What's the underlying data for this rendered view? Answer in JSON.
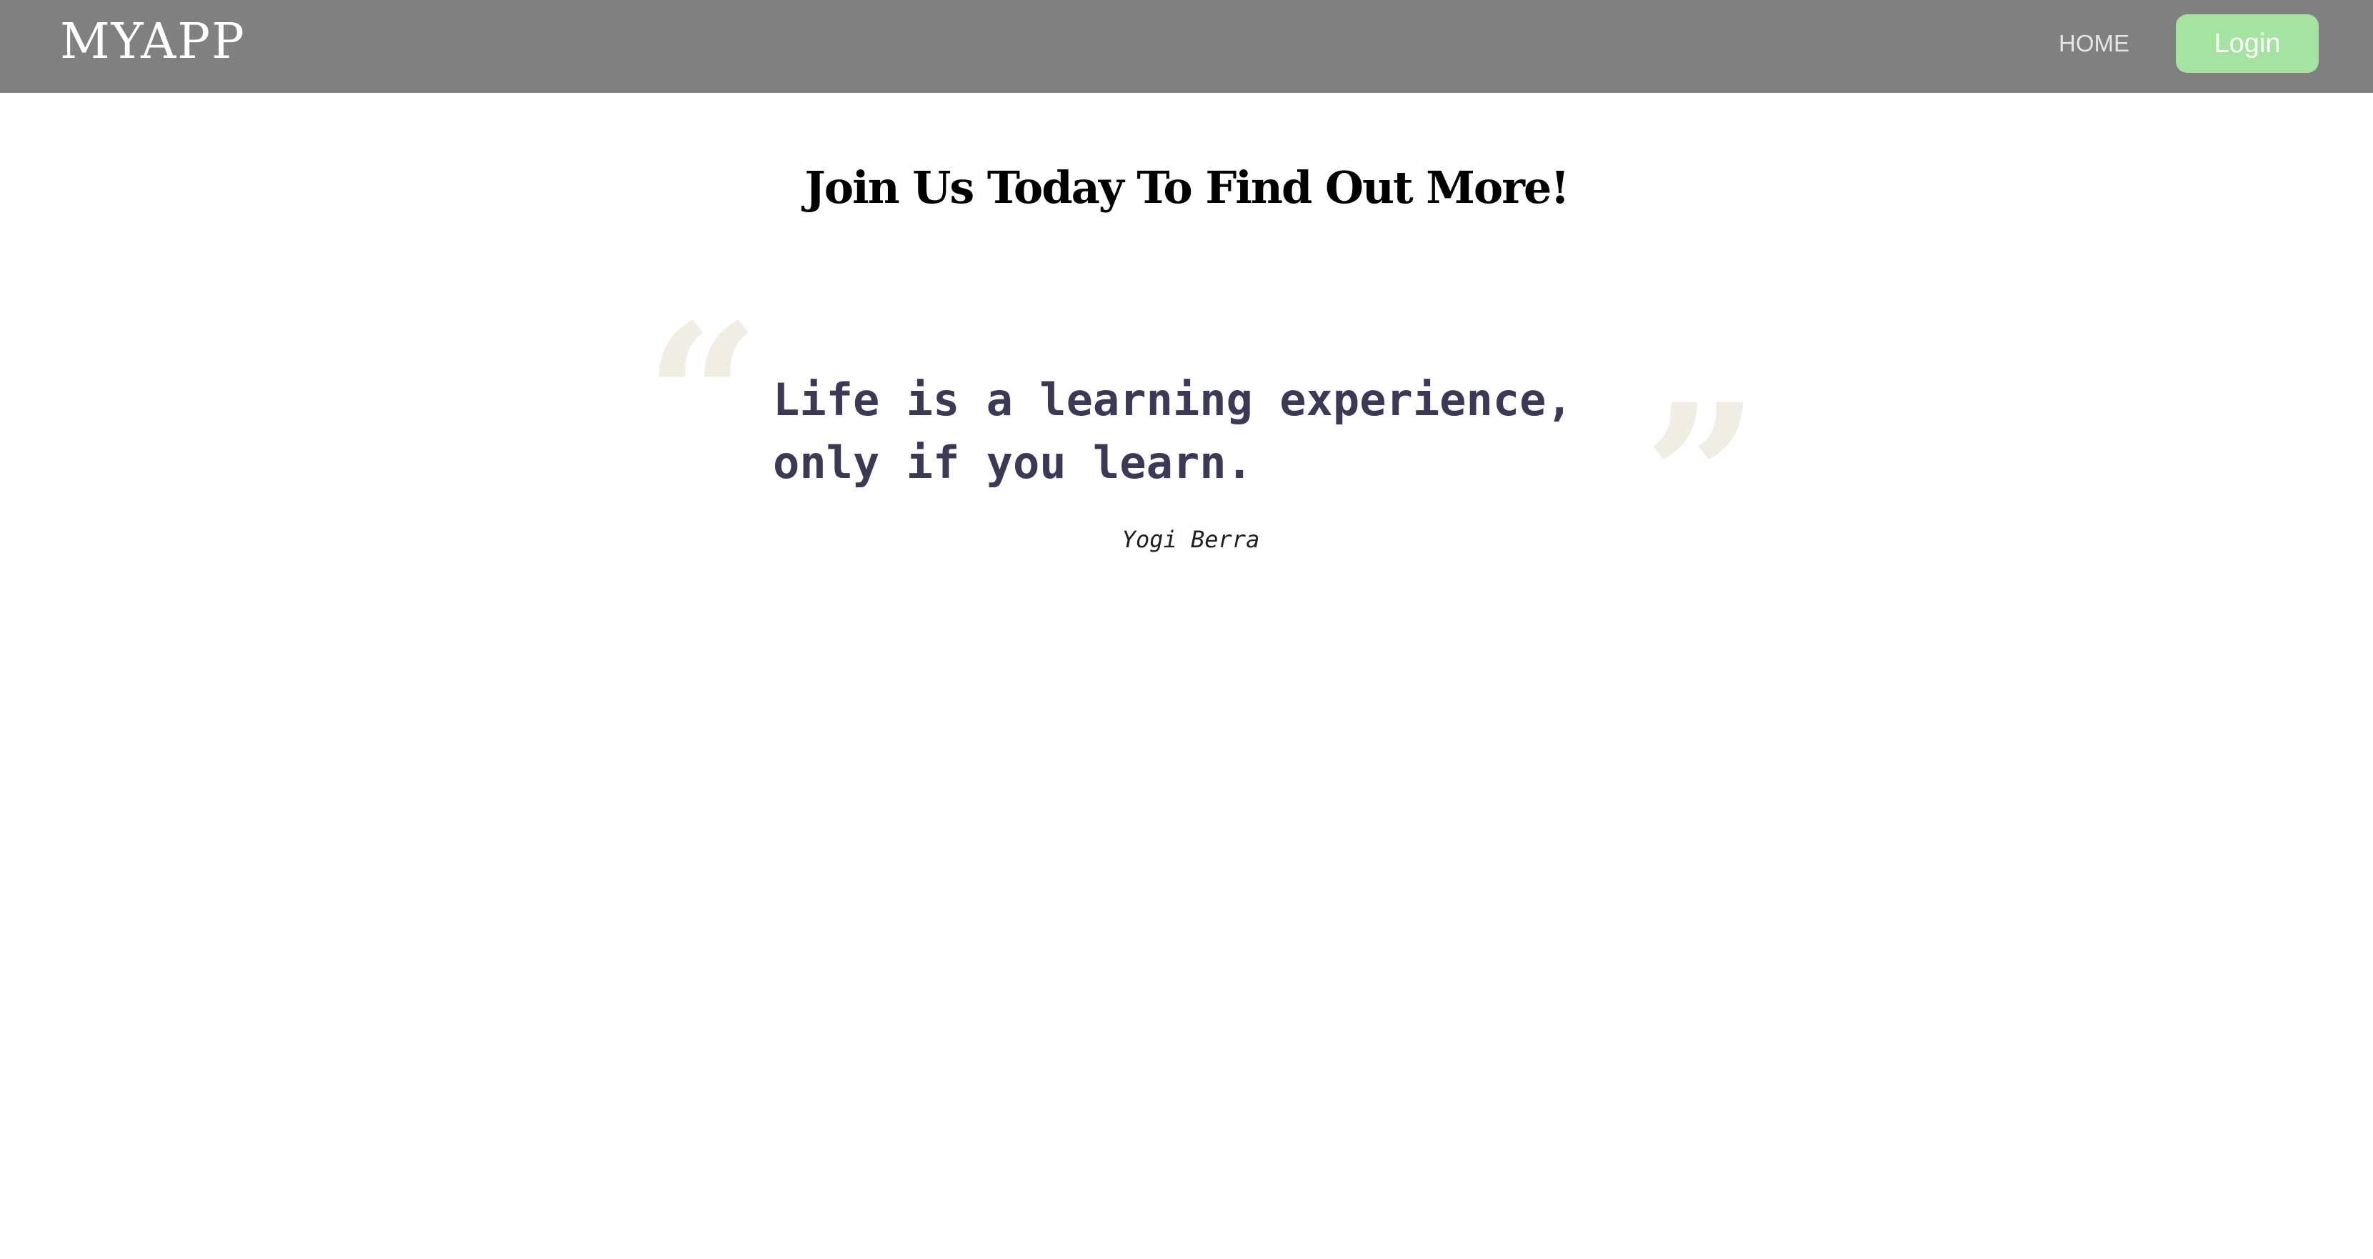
{
  "navbar": {
    "brand": "MYAPP",
    "home_label": "HOME",
    "login_label": "Login",
    "background": "#808080",
    "login_color": "#a5e3a0"
  },
  "main": {
    "headline": "Join Us Today To Find Out More!",
    "quote": {
      "open_mark": "“",
      "close_mark": "”",
      "line1": "Life is a learning experience,",
      "line2": "only if you learn.",
      "author": "Yogi Berra",
      "mark_color": "#efede4",
      "text_color": "#3b3a56"
    }
  }
}
